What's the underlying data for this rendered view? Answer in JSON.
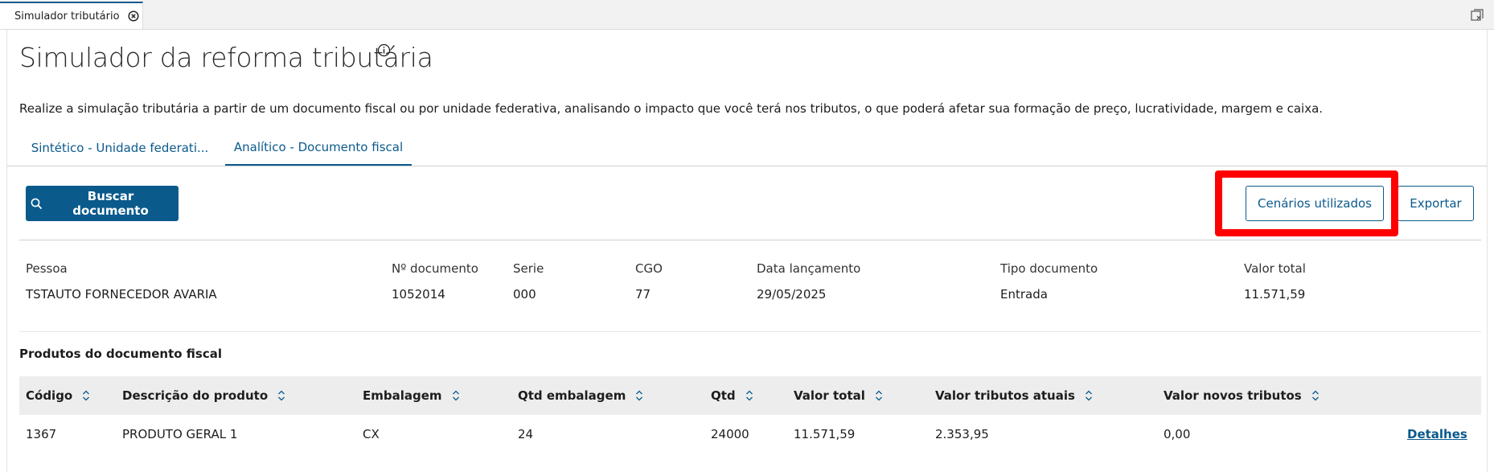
{
  "tabstrip": {
    "tab_label": "Simulador tributário"
  },
  "page": {
    "title": "Simulador da reforma tributária",
    "description": "Realize a simulação tributária a partir de um documento fiscal ou por unidade federativa, analisando o impacto que você terá nos tributos, o que poderá afetar sua formação de preço, lucratividade, margem e caixa."
  },
  "tabs": [
    {
      "label": "Sintético - Unidade federati..."
    },
    {
      "label": "Analítico - Documento fiscal"
    }
  ],
  "toolbar": {
    "search_label": "Buscar documento",
    "scenarios_label": "Cenários utilizados",
    "export_label": "Exportar"
  },
  "document": {
    "fields": [
      {
        "label": "Pessoa",
        "value": "TSTAUTO FORNECEDOR AVARIA"
      },
      {
        "label": "Nº documento",
        "value": "1052014"
      },
      {
        "label": "Serie",
        "value": "000"
      },
      {
        "label": "CGO",
        "value": "77"
      },
      {
        "label": "Data lançamento",
        "value": "29/05/2025"
      },
      {
        "label": "Tipo documento",
        "value": "Entrada"
      },
      {
        "label": "Valor total",
        "value": "11.571,59"
      }
    ]
  },
  "products": {
    "section_title": "Produtos do documento fiscal",
    "columns": [
      "Código",
      "Descrição do produto",
      "Embalagem",
      "Qtd embalagem",
      "Qtd",
      "Valor total",
      "Valor tributos atuais",
      "Valor novos tributos"
    ],
    "rows": [
      {
        "cells": [
          "1367",
          "PRODUTO GERAL 1",
          "CX",
          "24",
          "24000",
          "11.571,59",
          "2.353,95",
          "0,00"
        ],
        "action": "Detalhes"
      }
    ]
  },
  "colors": {
    "accent": "#0a5a8c",
    "highlight": "#ff0000"
  }
}
